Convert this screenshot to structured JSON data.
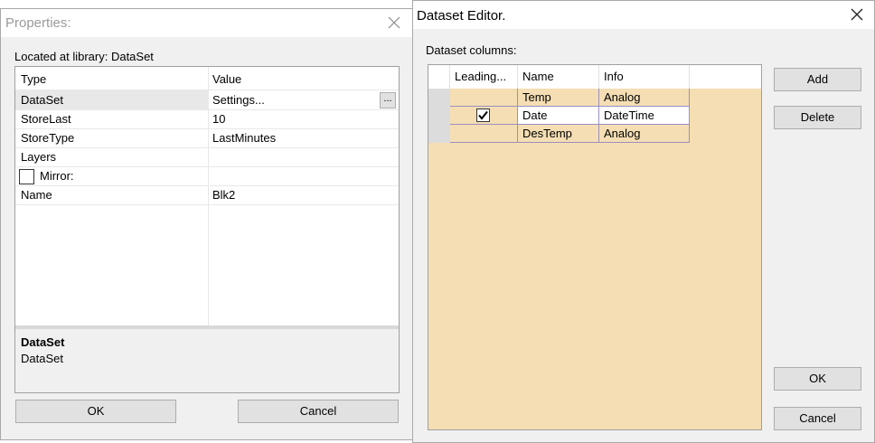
{
  "properties": {
    "title": "Properties:",
    "library_label": "Located at library: DataSet",
    "grid": {
      "headers": {
        "type": "Type",
        "value": "Value"
      },
      "rows": [
        {
          "name": "DataSet",
          "value": "Settings..."
        },
        {
          "name": "StoreLast",
          "value": "10"
        },
        {
          "name": "StoreType",
          "value": "LastMinutes"
        },
        {
          "name": "Layers",
          "value": ""
        },
        {
          "name": "Mirror:",
          "value": "",
          "checked": false
        },
        {
          "name": "Name",
          "value": "Blk2"
        }
      ],
      "ellipsis": "..."
    },
    "description": {
      "title": "DataSet",
      "text": "DataSet"
    },
    "ok_label": "OK",
    "cancel_label": "Cancel"
  },
  "editor": {
    "title": "Dataset Editor.",
    "columns_label": "Dataset columns:",
    "grid": {
      "headers": {
        "leading": "Leading...",
        "name": "Name",
        "info": "Info"
      },
      "rows": [
        {
          "leading": false,
          "name": "Temp",
          "info": "Analog"
        },
        {
          "leading": true,
          "name": "Date",
          "info": "DateTime"
        },
        {
          "leading": false,
          "name": "DesTemp",
          "info": "Analog"
        }
      ],
      "background_color": "#f5deb3"
    },
    "add_label": "Add",
    "delete_label": "Delete",
    "ok_label": "OK",
    "cancel_label": "Cancel"
  },
  "icons": {
    "close": "close-icon",
    "check": "check-icon"
  }
}
